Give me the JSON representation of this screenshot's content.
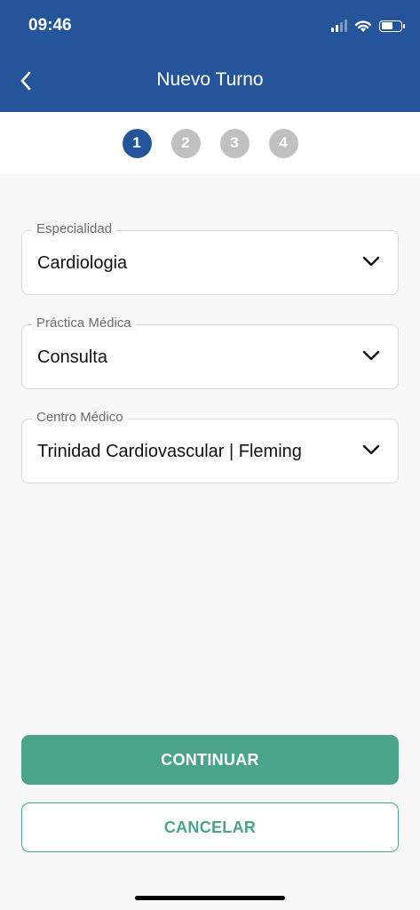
{
  "status_bar": {
    "time": "09:46"
  },
  "header": {
    "title": "Nuevo Turno",
    "back_icon": "chevron-left-icon"
  },
  "stepper": {
    "steps": [
      "1",
      "2",
      "3",
      "4"
    ],
    "active_step": 1
  },
  "form": {
    "especialidad": {
      "label": "Especialidad",
      "value": "Cardiologia"
    },
    "practica": {
      "label": "Práctica Médica",
      "value": "Consulta"
    },
    "centro": {
      "label": "Centro Médico",
      "value": "Trinidad Cardiovascular | Fleming"
    }
  },
  "actions": {
    "continue_label": "CONTINUAR",
    "cancel_label": "CANCELAR"
  },
  "colors": {
    "primary": "#24559b",
    "accent": "#4aa38d",
    "inactive_step": "#c0c0c0"
  }
}
